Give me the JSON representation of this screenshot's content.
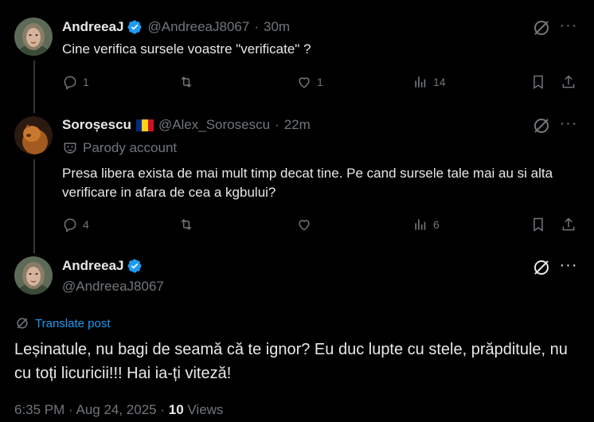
{
  "tweets": [
    {
      "name": "AndreeaJ",
      "handle": "@AndreeaJ8067",
      "time": "30m",
      "text": "Cine verifica sursele voastre \"verificate\" ?",
      "replies": "1",
      "retweets": "",
      "likes": "1",
      "views": "14"
    },
    {
      "name": "Soroșescu",
      "flag": "🇷🇴",
      "handle": "@Alex_Sorosescu",
      "time": "22m",
      "label": "Parody account",
      "text": "Presa libera exista de mai mult timp decat tine. Pe cand sursele tale mai au si alta verificare in afara de cea a kgbului?",
      "replies": "4",
      "retweets": "",
      "likes": "",
      "views": "6"
    }
  ],
  "main": {
    "name": "AndreeaJ",
    "handle": "@AndreeaJ8067",
    "translate": "Translate post",
    "text": "Leșinatule, nu bagi de seamă că te ignor? Eu duc lupte cu stele, prăpditule, nu cu toți licuricii!!! Hai ia-ți viteză!",
    "date": "6:35 PM · Aug 24, 2025 · ",
    "views_count": "10",
    "views_label": " Views"
  },
  "colors": {
    "accent": "#1d9bf0",
    "muted": "#71767b",
    "text": "#e7e9ea",
    "bg": "#000000"
  }
}
